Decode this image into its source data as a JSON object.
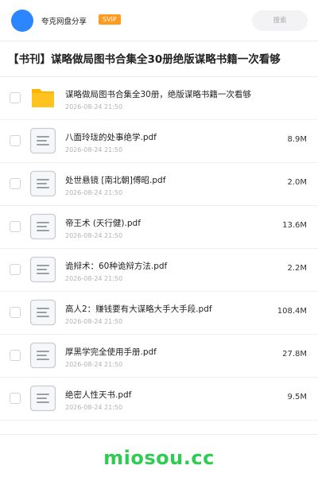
{
  "header": {
    "brand": "夸克网盘分享",
    "badge": "SVIP",
    "search_placeholder": "搜索"
  },
  "colors": {
    "accent": "#2b86ff",
    "badge": "#ff9b1f",
    "folder": "#ffc31f",
    "watermark": "#2fcc52"
  },
  "page": {
    "title": "【书刊】谋略做局图书合集全30册绝版谋略书籍一次看够"
  },
  "files": [
    {
      "type": "folder",
      "icon": "folder-icon",
      "name": "谋略做局图书合集全30册，绝版谋略书籍一次看够",
      "date": "2026-08-24 21:50",
      "size": ""
    },
    {
      "type": "file",
      "icon": "document-icon",
      "name": "八面玲珑的处事绝学.pdf",
      "date": "2026-08-24 21:50",
      "size": "8.9M"
    },
    {
      "type": "file",
      "icon": "document-icon",
      "name": "处世悬镜 [南北朝]傅昭.pdf",
      "date": "2026-08-24 21:50",
      "size": "2.0M"
    },
    {
      "type": "file",
      "icon": "document-icon",
      "name": "帝王术 (天行健).pdf",
      "date": "2026-08-24 21:50",
      "size": "13.6M"
    },
    {
      "type": "file",
      "icon": "document-icon",
      "name": "诡辩术：60种诡辩方法.pdf",
      "date": "2026-08-24 21:50",
      "size": "2.2M"
    },
    {
      "type": "file",
      "icon": "document-icon",
      "name": "高人2：赚钱要有大谋略大手大手段.pdf",
      "date": "2026-08-24 21:50",
      "size": "108.4M"
    },
    {
      "type": "file",
      "icon": "document-icon",
      "name": "厚黑学完全使用手册.pdf",
      "date": "2026-08-24 21:50",
      "size": "27.8M"
    },
    {
      "type": "file",
      "icon": "document-icon",
      "name": "绝密人性天书.pdf",
      "date": "2026-08-24 21:50",
      "size": "9.5M"
    }
  ],
  "watermark": "miosou.cc"
}
